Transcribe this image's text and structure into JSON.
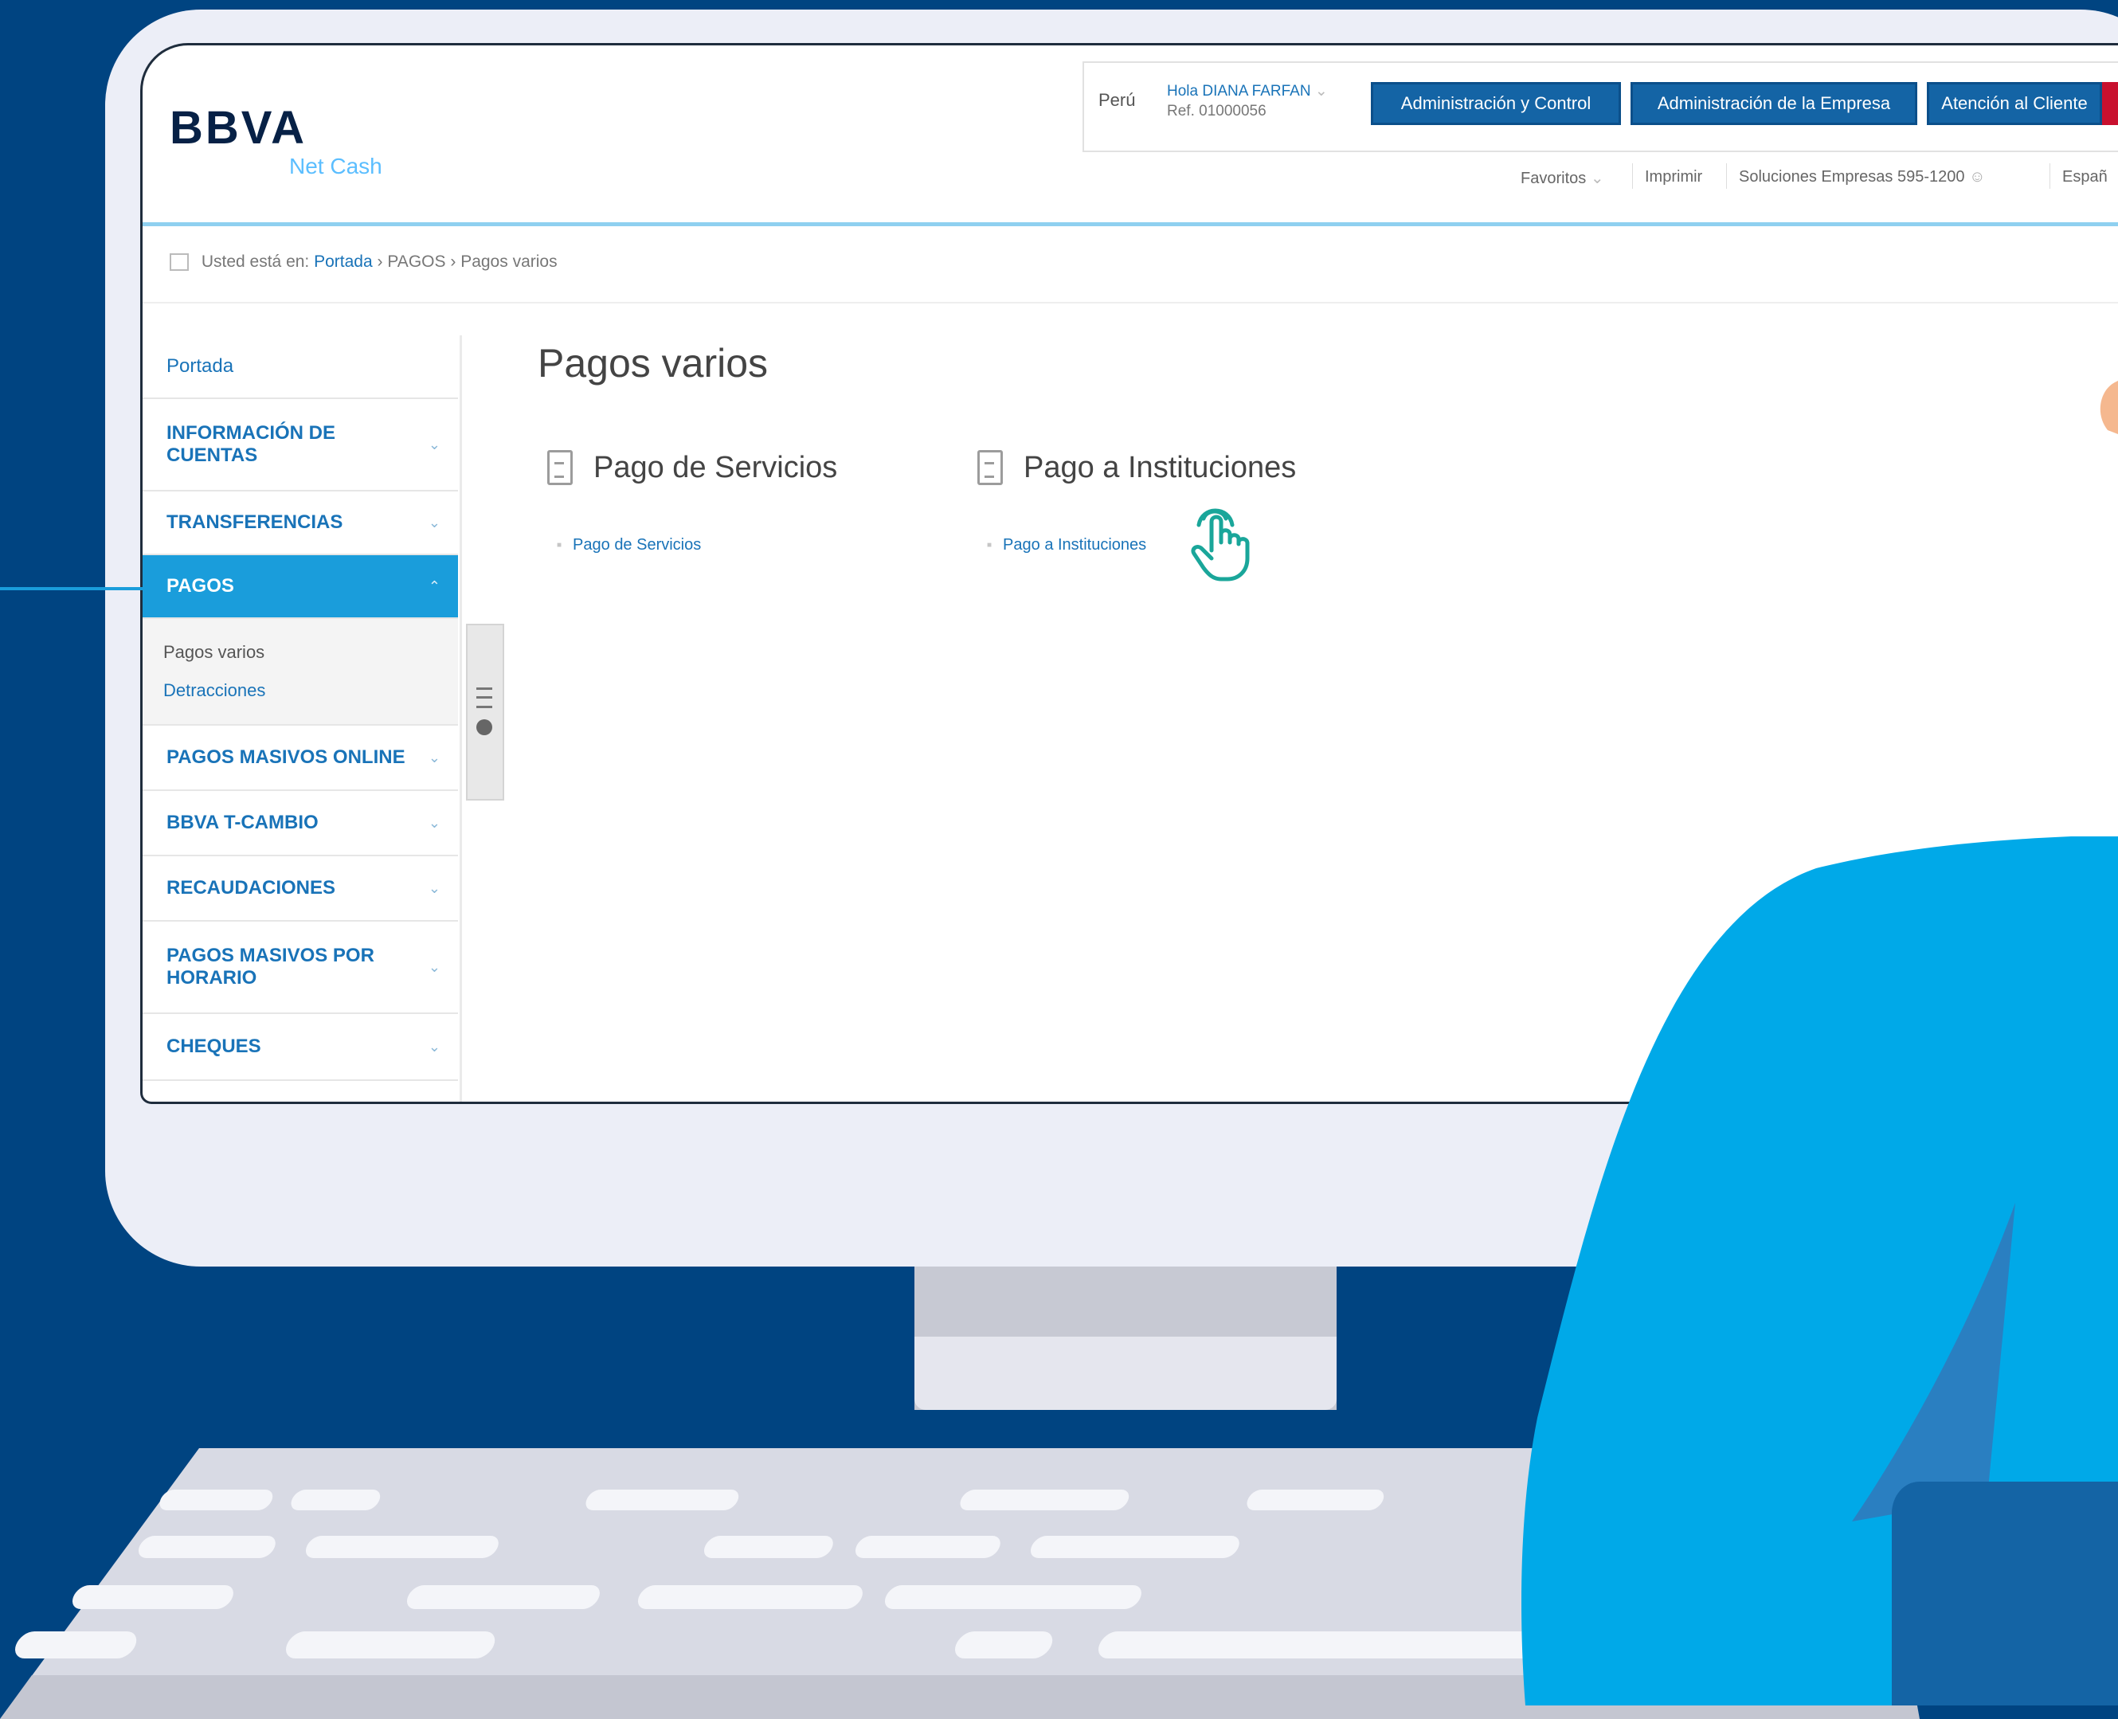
{
  "brand": {
    "logo": "BBVA",
    "product": "Net Cash"
  },
  "header": {
    "country": "Perú",
    "user_greeting": "Hola DIANA FARFAN",
    "user_ref": "Ref. 01000056",
    "buttons": [
      "Administración y Control",
      "Administración de la Empresa",
      "Atención al Cliente"
    ],
    "links": {
      "favorites": "Favoritos",
      "print": "Imprimir",
      "solutions": "Soluciones Empresas 595-1200",
      "language": "Españ"
    }
  },
  "breadcrumb": {
    "prefix": "Usted está en:",
    "home": "Portada",
    "sep1": "›",
    "section": "PAGOS",
    "sep2": "›",
    "current": "Pagos varios"
  },
  "sidebar": {
    "items": [
      {
        "label": "Portada",
        "chevron": ""
      },
      {
        "label_line1": "INFORMACIÓN DE",
        "label_line2": "CUENTAS",
        "chevron": "⌄"
      },
      {
        "label": "TRANSFERENCIAS",
        "chevron": "⌄"
      },
      {
        "label": "PAGOS",
        "chevron": "⌃"
      },
      {
        "label": "PAGOS MASIVOS ONLINE",
        "chevron": "⌄"
      },
      {
        "label": "BBVA T-CAMBIO",
        "chevron": "⌄"
      },
      {
        "label": "RECAUDACIONES",
        "chevron": "⌄"
      },
      {
        "label_line1": "PAGOS MASIVOS POR",
        "label_line2": "HORARIO",
        "chevron": "⌄"
      },
      {
        "label": "CHEQUES",
        "chevron": "⌄"
      }
    ],
    "subitems": [
      "Pagos varios",
      "Detracciones"
    ]
  },
  "main": {
    "title": "Pagos varios",
    "sections": [
      {
        "title": "Pago de Servicios",
        "link": "Pago de Servicios"
      },
      {
        "title": "Pago a Instituciones",
        "link": "Pago a Instituciones"
      }
    ]
  },
  "colors": {
    "page_background": "#004481",
    "accent_blue": "#1a9ddb",
    "button_blue": "#1464a5",
    "link_blue": "#1973b8",
    "monitor": "#eceef7",
    "person_blue": "#00a9e8"
  },
  "icons": [
    "home-icon",
    "document-icon",
    "hand-pointer-icon",
    "menu-icon",
    "chevron-down-icon",
    "chevron-up-icon",
    "user-icon"
  ]
}
